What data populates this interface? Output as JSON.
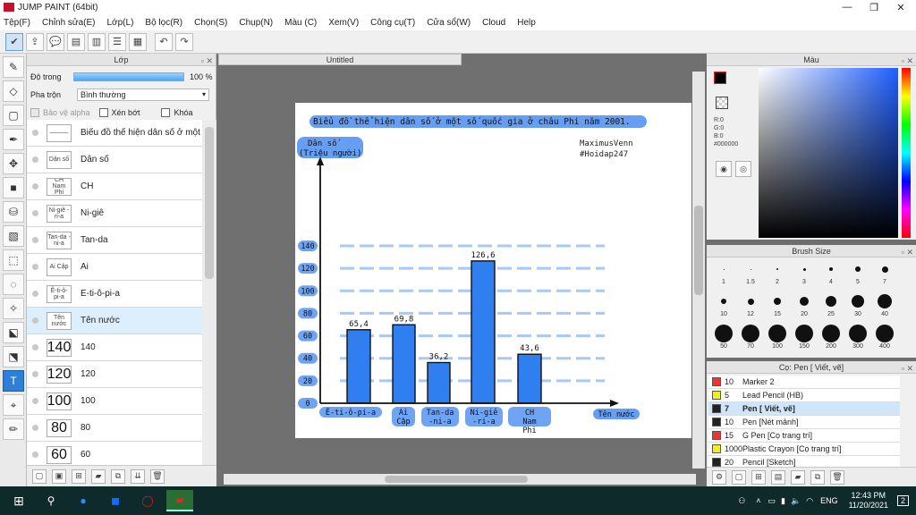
{
  "app": {
    "title": "JUMP PAINT (64bit)"
  },
  "menu": [
    "Tệp(F)",
    "Chỉnh sửa(E)",
    "Lớp(L)",
    "Bộ lọc(R)",
    "Chọn(S)",
    "Chụp(N)",
    "Màu (C)",
    "Xem(V)",
    "Công cụ(T)",
    "Cửa sổ(W)",
    "Cloud",
    "Help"
  ],
  "layer_panel": {
    "title": "Lớp",
    "opacity_label": "Độ trong",
    "opacity_value": "100 %",
    "opacity_fraction": 1.0,
    "blend_label": "Pha trộn",
    "blend_value": "Bình thường",
    "protect_alpha": "Bảo vệ alpha",
    "clipping": "Xén bớt",
    "lock": "Khóa",
    "layers": [
      {
        "thumb": "———",
        "name": "Biểu đồ thể hiện dân số ở một",
        "big": false
      },
      {
        "thumb": "Dân số",
        "name": "Dân số",
        "big": false
      },
      {
        "thumb": "CH Nam Phi",
        "name": "CH",
        "big": false
      },
      {
        "thumb": "Ni-giê -ri-a",
        "name": "Ni-giê",
        "big": false
      },
      {
        "thumb": "Tan-da -ni-a",
        "name": "Tan-da",
        "big": false
      },
      {
        "thumb": "Ai Cập",
        "name": "Ai",
        "big": false
      },
      {
        "thumb": "Ê-ti-ô-pi-a",
        "name": "Ê-ti-ô-pi-a",
        "big": false
      },
      {
        "thumb": "Tên nước",
        "name": "Tên nước",
        "big": false
      },
      {
        "thumb": "140",
        "name": "140",
        "big": true
      },
      {
        "thumb": "120",
        "name": "120",
        "big": true
      },
      {
        "thumb": "100",
        "name": "100",
        "big": true
      },
      {
        "thumb": "80",
        "name": "80",
        "big": true
      },
      {
        "thumb": "60",
        "name": "60",
        "big": true
      }
    ]
  },
  "document": {
    "tab": "Untitled"
  },
  "chart_data": {
    "type": "bar",
    "title": "Biểu đồ thể hiện dân số ở một số quốc gia ở châu Phi năm 2001.",
    "ylabel": "Dân số (Triệu người)",
    "xlabel": "Tên nước",
    "credit1": "MaximusVenn",
    "credit2": "#Hoidap247",
    "categories": [
      "Ê-ti-ô-pi-a",
      "Ai Cập",
      "Tan-da -ni-a",
      "Ni-giê -ri-a",
      "CH Nam Phi"
    ],
    "values": [
      65.4,
      69.8,
      36.2,
      126.6,
      43.6
    ],
    "value_labels": [
      "65,4",
      "69,8",
      "36,2",
      "126,6",
      "43,6"
    ],
    "yticks": [
      0,
      20,
      40,
      60,
      80,
      100,
      120,
      140
    ],
    "ylim": [
      0,
      160
    ],
    "bar_color": "#2f7ff0",
    "grid_color": "#a8c8f5"
  },
  "color_panel": {
    "title": "Màu",
    "r": "R:0",
    "g": "G:0",
    "b": "B:0",
    "hex": "#000000"
  },
  "brush_panel": {
    "title": "Brush Size",
    "sizes": [
      "1",
      "1.5",
      "2",
      "3",
      "4",
      "5",
      "7",
      "10",
      "12",
      "15",
      "20",
      "25",
      "30",
      "40",
      "50",
      "70",
      "100",
      "150",
      "200",
      "300",
      "400"
    ]
  },
  "sub_panel": {
    "title": "Cọ: Pen [ Viết, vẽ]",
    "items": [
      {
        "size": "10",
        "name": "Marker 2",
        "color": "#e33"
      },
      {
        "size": "5",
        "name": "Lead Pencil (HB)",
        "color": "#ee2"
      },
      {
        "size": "7",
        "name": "Pen [ Viết, vẽ]",
        "color": "#222"
      },
      {
        "size": "10",
        "name": "Pen [Nét mảnh]",
        "color": "#222"
      },
      {
        "size": "15",
        "name": "G Pen [Cọ trang trí]",
        "color": "#e33"
      },
      {
        "size": "1000",
        "name": "Plastic Crayon [Cọ trang trí]",
        "color": "#ee2"
      },
      {
        "size": "20",
        "name": "Pencil [Sketch]",
        "color": "#222"
      }
    ]
  },
  "taskbar": {
    "lang": "ENG",
    "time": "12:43 PM",
    "date": "11/20/2021",
    "notif": "2"
  }
}
